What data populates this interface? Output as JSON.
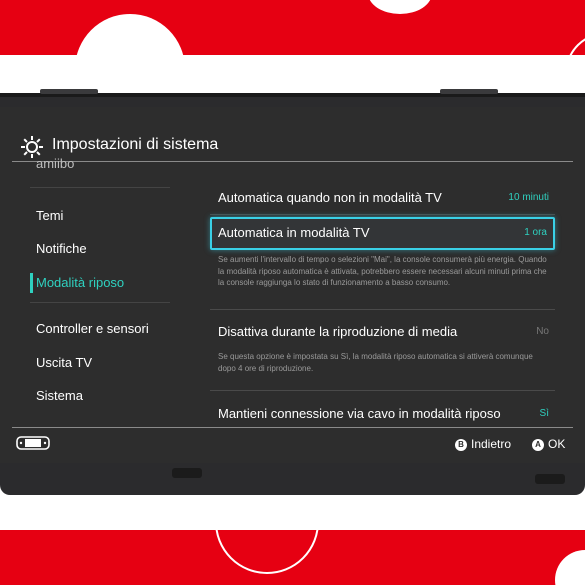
{
  "header": {
    "title": "Impostazioni di sistema",
    "icon": "gear-icon"
  },
  "sidebar": {
    "clipped_item": "amiibo",
    "items": [
      {
        "label": "Temi"
      },
      {
        "label": "Notifiche"
      },
      {
        "label": "Modalità riposo",
        "active": true
      },
      {
        "label": "Controller e sensori"
      },
      {
        "label": "Uscita TV"
      },
      {
        "label": "Sistema"
      }
    ]
  },
  "content": {
    "row1": {
      "label": "Automatica quando non in modalità TV",
      "value": "10 minuti"
    },
    "row2": {
      "label": "Automatica in modalità TV",
      "value": "1 ora",
      "description": "Se aumenti l'intervallo di tempo o selezioni \"Mai\", la console consumerà più energia. Quando la modalità riposo automatica è attivata, potrebbero essere necessari alcuni minuti prima che la console raggiunga lo stato di funzionamento a basso consumo."
    },
    "row3": {
      "label": "Disattiva durante la riproduzione di media",
      "value": "No",
      "description": "Se questa opzione è impostata su Sì, la modalità riposo automatica si attiverà comunque dopo 4 ore di riproduzione."
    },
    "row4": {
      "label": "Mantieni connessione via cavo in modalità riposo",
      "value": "Sì"
    }
  },
  "footer": {
    "back": {
      "glyph": "B",
      "label": "Indietro"
    },
    "ok": {
      "glyph": "A",
      "label": "OK"
    },
    "controller_icon": "handheld-controller-icon"
  },
  "colors": {
    "accent": "#2fd1c0",
    "selection": "#3ad0e6",
    "background": "#2d2d2d",
    "promo_red": "#e60012"
  }
}
